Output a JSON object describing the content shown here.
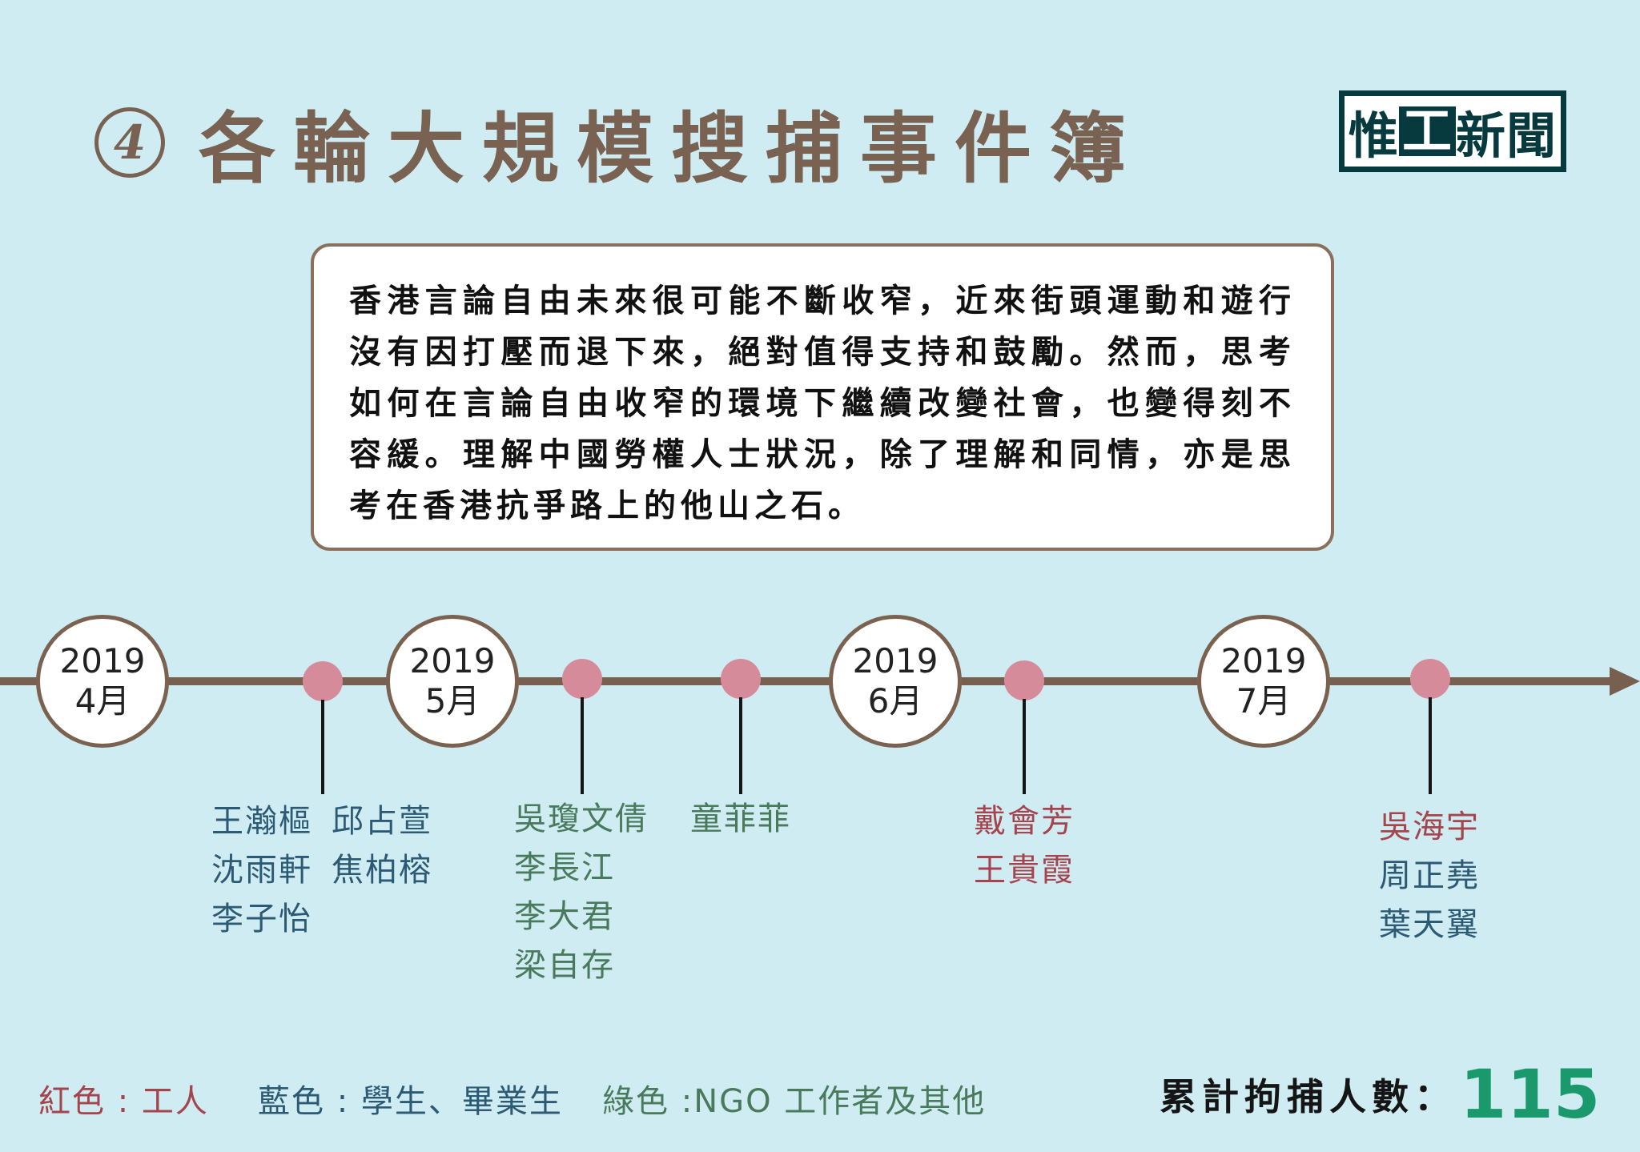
{
  "header": {
    "number": "4",
    "title": "各輪大規模搜捕事件簿"
  },
  "logo": {
    "part1": "惟",
    "part2": "工",
    "part3": "新聞"
  },
  "intro_text": "香港言論自由未來很可能不斷收窄，近來街頭運動和遊行沒有因打壓而退下來，絕對值得支持和鼓勵。然而，思考如何在言論自由收窄的環境下繼續改變社會，也變得刻不容緩。理解中國勞權人士狀況，除了理解和同情，亦是思考在香港抗爭路上的他山之石。",
  "timeline": {
    "months": [
      {
        "year": "2019",
        "month": "4月"
      },
      {
        "year": "2019",
        "month": "5月"
      },
      {
        "year": "2019",
        "month": "6月"
      },
      {
        "year": "2019",
        "month": "7月"
      }
    ],
    "events": [
      {
        "category": "blue",
        "rows": [
          [
            "王瀚樞",
            "邱占萱"
          ],
          [
            "沈雨軒",
            "焦柏榕"
          ],
          [
            "李子怡"
          ]
        ]
      },
      {
        "category": "green",
        "rows": [
          [
            "吳瓊文倩"
          ],
          [
            "李長江"
          ],
          [
            "李大君"
          ],
          [
            "梁自存"
          ]
        ]
      },
      {
        "category": "green",
        "rows": [
          [
            "童菲菲"
          ]
        ]
      },
      {
        "category": "red",
        "rows": [
          [
            "戴會芳"
          ],
          [
            "王貴霞"
          ]
        ]
      },
      {
        "category": "mixed",
        "rows": [
          [
            "吳海宇"
          ],
          [
            "周正堯"
          ],
          [
            "葉天翼"
          ]
        ]
      }
    ]
  },
  "legend": {
    "red": "紅色 : 工人",
    "blue": "藍色 : 學生、畢業生",
    "green": "綠色 :NGO 工作者及其他"
  },
  "total": {
    "label": "累計拘捕人數：",
    "value": "115"
  },
  "colors": {
    "background": "#ceecf1",
    "title": "#7a6252",
    "axis": "#77604f",
    "dot": "#d68b9b",
    "red": "#a5444d",
    "blue": "#2c5a74",
    "green": "#4a7a5c",
    "total_value": "#1a9a6c"
  }
}
